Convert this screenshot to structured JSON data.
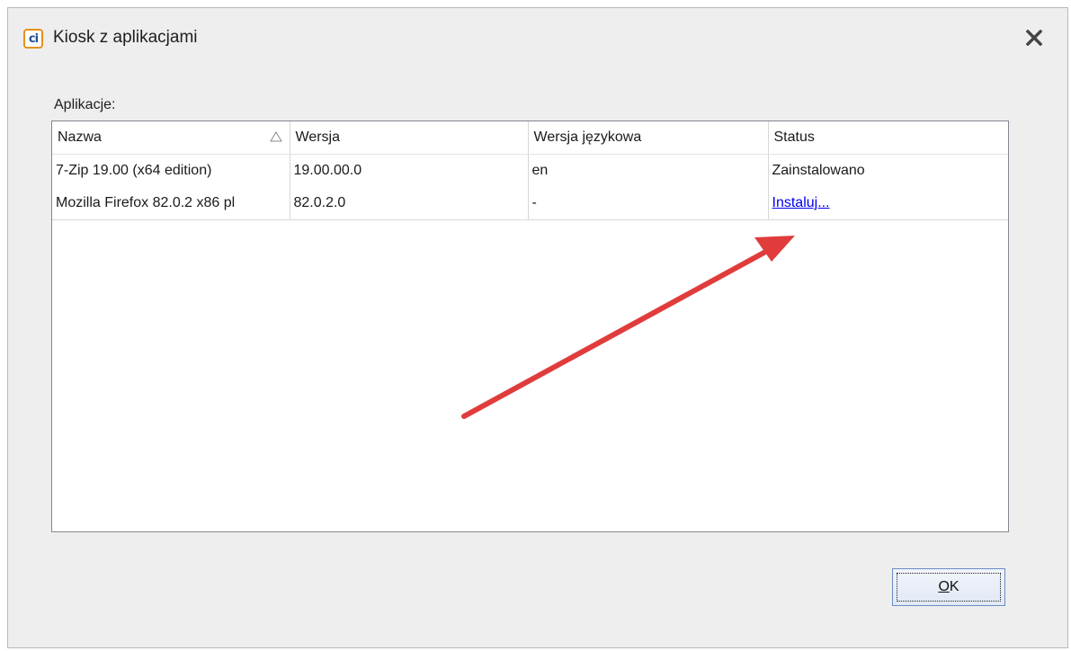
{
  "window": {
    "title": "Kiosk z aplikacjami",
    "icon": "app-logo-icon",
    "icon_text": "ci",
    "close_icon": "close-icon"
  },
  "apps_label": "Aplikacje:",
  "table": {
    "columns": [
      "Nazwa",
      "Wersja",
      "Wersja językowa",
      "Status"
    ],
    "sorted_column": "Nazwa",
    "sort_direction": "ascending",
    "rows": [
      {
        "name": "7-Zip 19.00 (x64 edition)",
        "version": "19.00.00.0",
        "language": "en",
        "status": "Zainstalowano",
        "status_is_link": false
      },
      {
        "name": "Mozilla Firefox 82.0.2 x86 pl",
        "version": "82.0.2.0",
        "language": "-",
        "status": "Instaluj...",
        "status_is_link": true
      }
    ]
  },
  "annotation": {
    "type": "red-arrow",
    "color": "#e03c3c",
    "points_to": "Instaluj..."
  },
  "ok_button": {
    "mnemonic": "O",
    "rest": "K"
  },
  "colors": {
    "link": "#0000ee",
    "window_bg": "#eeeeee",
    "accent_icon": "#e8911c"
  }
}
